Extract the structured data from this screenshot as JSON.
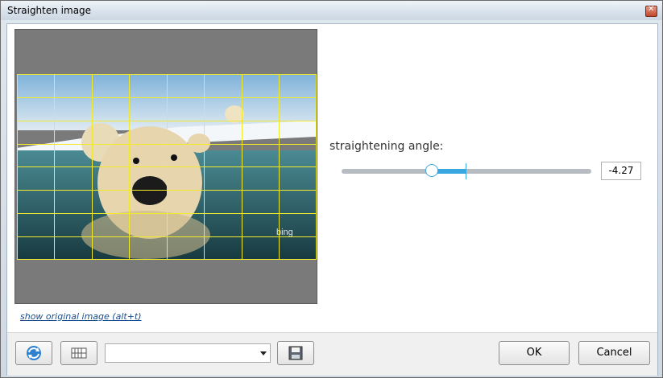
{
  "window": {
    "title": "Straighten image"
  },
  "preview": {
    "show_original_link": "show original image (alt+t)",
    "watermark": "bing"
  },
  "angle": {
    "label": "straightening angle:",
    "value": "-4.27"
  },
  "toolbar": {
    "preset_select_value": ""
  },
  "buttons": {
    "ok": "OK",
    "cancel": "Cancel"
  },
  "colors": {
    "accent": "#3aa8e0",
    "grid": "#f2ea2a",
    "preview_bg": "#7a7a7a"
  },
  "icons": {
    "reset": "refresh-icon",
    "grid_toggle": "grid-icon",
    "save": "save-icon",
    "close": "close-icon"
  }
}
